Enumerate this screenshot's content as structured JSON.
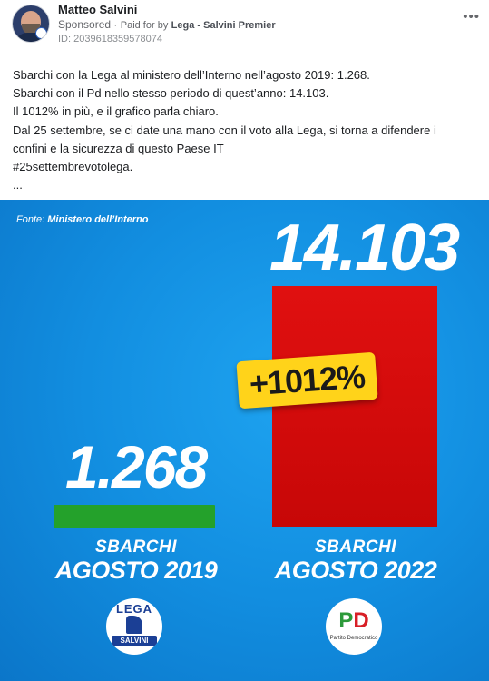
{
  "post": {
    "author": "Matteo Salvini",
    "sponsored_label": "Sponsored",
    "paid_for_label": "Paid for by",
    "paid_for_page": "Lega - Salvini Premier",
    "ad_id": "ID: 2039618359578074",
    "more_icon": "ellipsis-icon",
    "caption_lines": [
      "Sbarchi con la Lega al ministero dell’Interno nell’agosto 2019: 1.268.",
      "Sbarchi con il Pd nello stesso periodo di quest’anno: 14.103.",
      "Il 1012% in più, e il grafico parla chiaro.",
      "Dal 25 settembre, se ci date una mano con il voto alla Lega, si torna a difendere i",
      "confini e la sicurezza di questo Paese IT",
      "#25settembrevotolega.",
      "..."
    ]
  },
  "image": {
    "source_label": "Fonte:",
    "source_value": "Ministero dell’Interno",
    "left": {
      "value_text": "1.268",
      "line1": "SBARCHI",
      "line2": "AGOSTO 2019"
    },
    "right": {
      "value_text": "14.103",
      "line1": "SBARCHI",
      "line2": "AGOSTO 2022"
    },
    "increase_badge": "+1012%",
    "logos": {
      "lega_top": "LEGA",
      "lega_bottom": "SALVINI",
      "pd_p": "P",
      "pd_d": "D",
      "pd_sub": "Partito Democratico"
    },
    "colors": {
      "background": "#128ee0",
      "bar_2019": "#24a12b",
      "bar_2022": "#d50c0c",
      "badge": "#ffd31a"
    }
  }
}
